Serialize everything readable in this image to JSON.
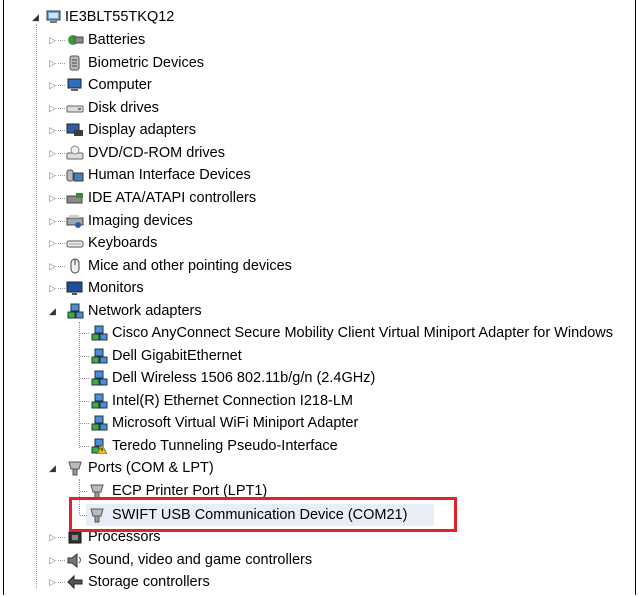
{
  "root": {
    "label": "IE3BLT55TKQ12",
    "icon": "computer-root-icon"
  },
  "categories": [
    {
      "label": "Batteries",
      "icon": "battery-icon"
    },
    {
      "label": "Biometric Devices",
      "icon": "biometric-icon"
    },
    {
      "label": "Computer",
      "icon": "computer-icon"
    },
    {
      "label": "Disk drives",
      "icon": "disk-drive-icon"
    },
    {
      "label": "Display adapters",
      "icon": "display-adapter-icon"
    },
    {
      "label": "DVD/CD-ROM drives",
      "icon": "dvd-drive-icon"
    },
    {
      "label": "Human Interface Devices",
      "icon": "hid-icon"
    },
    {
      "label": "IDE ATA/ATAPI controllers",
      "icon": "ide-controller-icon"
    },
    {
      "label": "Imaging devices",
      "icon": "imaging-device-icon"
    },
    {
      "label": "Keyboards",
      "icon": "keyboard-icon"
    },
    {
      "label": "Mice and other pointing devices",
      "icon": "mouse-icon"
    },
    {
      "label": "Monitors",
      "icon": "monitor-icon"
    },
    {
      "label": "Network adapters",
      "icon": "network-adapter-icon"
    }
  ],
  "network_adapters": [
    {
      "label": "Cisco AnyConnect Secure Mobility Client Virtual Miniport Adapter for Windows",
      "icon": "network-adapter-icon"
    },
    {
      "label": "Dell GigabitEthernet",
      "icon": "network-adapter-icon"
    },
    {
      "label": "Dell Wireless 1506 802.11b/g/n (2.4GHz)",
      "icon": "network-adapter-icon"
    },
    {
      "label": "Intel(R) Ethernet Connection I218-LM",
      "icon": "network-adapter-icon"
    },
    {
      "label": "Microsoft Virtual WiFi Miniport Adapter",
      "icon": "network-adapter-icon"
    },
    {
      "label": "Teredo Tunneling Pseudo-Interface",
      "icon": "network-adapter-warning-icon"
    }
  ],
  "ports": {
    "label": "Ports (COM & LPT)",
    "icon": "port-icon",
    "children": [
      {
        "label": "ECP Printer Port (LPT1)",
        "icon": "port-icon"
      },
      {
        "label": "SWIFT USB Communication Device (COM21)",
        "icon": "port-icon"
      }
    ]
  },
  "after_ports": [
    {
      "label": "Processors",
      "icon": "processor-icon"
    },
    {
      "label": "Sound, video and game controllers",
      "icon": "sound-icon"
    },
    {
      "label": "Storage controllers",
      "icon": "storage-controller-icon"
    }
  ],
  "highlight_color": "#e0222a"
}
